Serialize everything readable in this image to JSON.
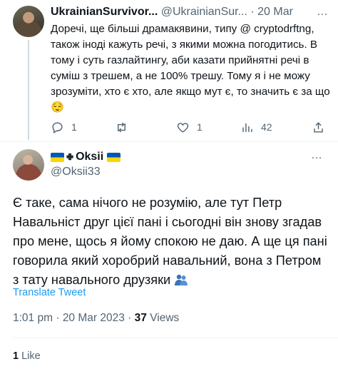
{
  "parent_tweet": {
    "display_name": "UkrainianSurvivor...",
    "handle": "@UkrainianSur...",
    "separator": "·",
    "date": "20 Mar",
    "text": "Доречі, ще більші драмакявини, типу @ cryptodrftng, також іноді кажуть речі, з якими можна погодитись. В тому і суть газлайтингу, аби казати прийнятні речі в суміш з трешем, а не 100% трешу. Тому я і не можу зрозуміти, хто є хто, але якщо мут є, то значить є за що 😌",
    "actions": {
      "replies": "1",
      "retweets": "",
      "likes": "1",
      "views": "42"
    }
  },
  "main_tweet": {
    "display_name": "Oksii",
    "flag_glyph": "✙",
    "handle": "@Oksii33",
    "text": "Є таке, сама нічого не розумію, але тут Петр Навальніст друг цієї пані і сьогодні він знову згадав про мене, щось я йому спокою не даю. А ще ця пані говорила який хоробрий навальний, вона з Петром з тату навального друзяки",
    "translate_label": "Translate Tweet",
    "time": "1:01 pm",
    "date_sep": "·",
    "date": "20 Mar 2023",
    "meta_sep": "·",
    "views_count": "37",
    "views_label": "Views",
    "likes_count": "1",
    "likes_label": "Like"
  },
  "ui": {
    "more_glyph": "…",
    "accent_color": "#1d9bf0",
    "icons": [
      "reply-icon",
      "retweet-icon",
      "like-icon",
      "views-icon",
      "share-icon"
    ]
  }
}
